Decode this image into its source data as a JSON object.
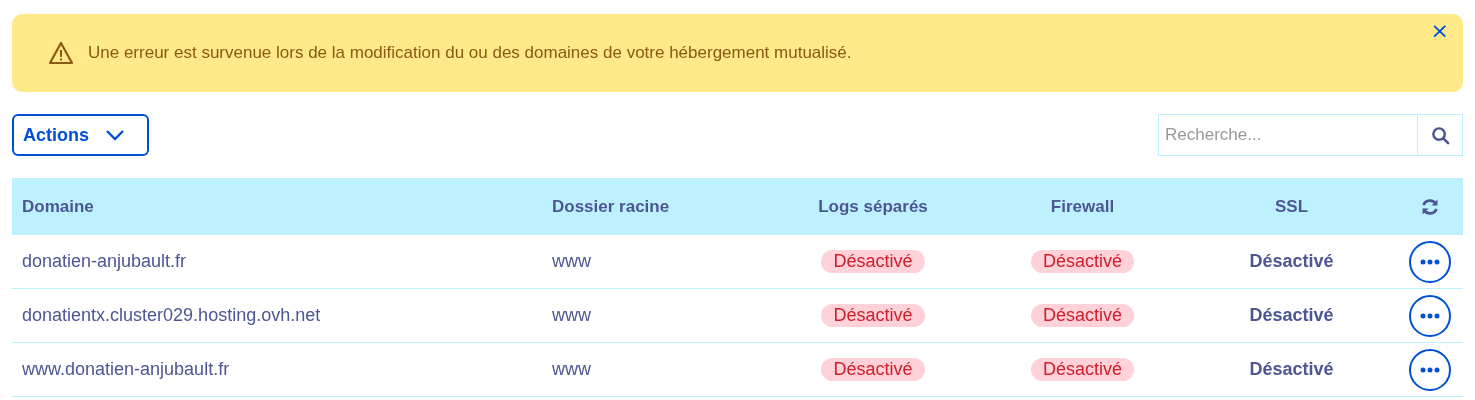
{
  "alert": {
    "message": "Une erreur est survenue lors de la modification du ou des domaines de votre hébergement mutualisé.",
    "close": "×"
  },
  "toolbar": {
    "actions_label": "Actions",
    "search": {
      "placeholder": "Recherche..."
    }
  },
  "table": {
    "columns": [
      "Domaine",
      "Dossier racine",
      "Logs séparés",
      "Firewall",
      "SSL"
    ],
    "rows": [
      {
        "cells": [
          {
            "kind": "plain",
            "text": "donatien-anjubault.fr"
          },
          {
            "kind": "plain",
            "text": "www"
          },
          {
            "kind": "badge",
            "text": "Désactivé"
          },
          {
            "kind": "badge",
            "text": "Désactivé"
          },
          {
            "kind": "strong",
            "text": "Désactivé"
          }
        ]
      },
      {
        "cells": [
          {
            "kind": "plain",
            "text": "donatientx.cluster029.hosting.ovh.net"
          },
          {
            "kind": "plain",
            "text": "www"
          },
          {
            "kind": "badge",
            "text": "Désactivé"
          },
          {
            "kind": "badge",
            "text": "Désactivé"
          },
          {
            "kind": "strong",
            "text": "Désactivé"
          }
        ]
      },
      {
        "cells": [
          {
            "kind": "plain",
            "text": "www.donatien-anjubault.fr"
          },
          {
            "kind": "plain",
            "text": "www"
          },
          {
            "kind": "badge",
            "text": "Désactivé"
          },
          {
            "kind": "badge",
            "text": "Désactivé"
          },
          {
            "kind": "strong",
            "text": "Désactivé"
          }
        ]
      }
    ]
  }
}
